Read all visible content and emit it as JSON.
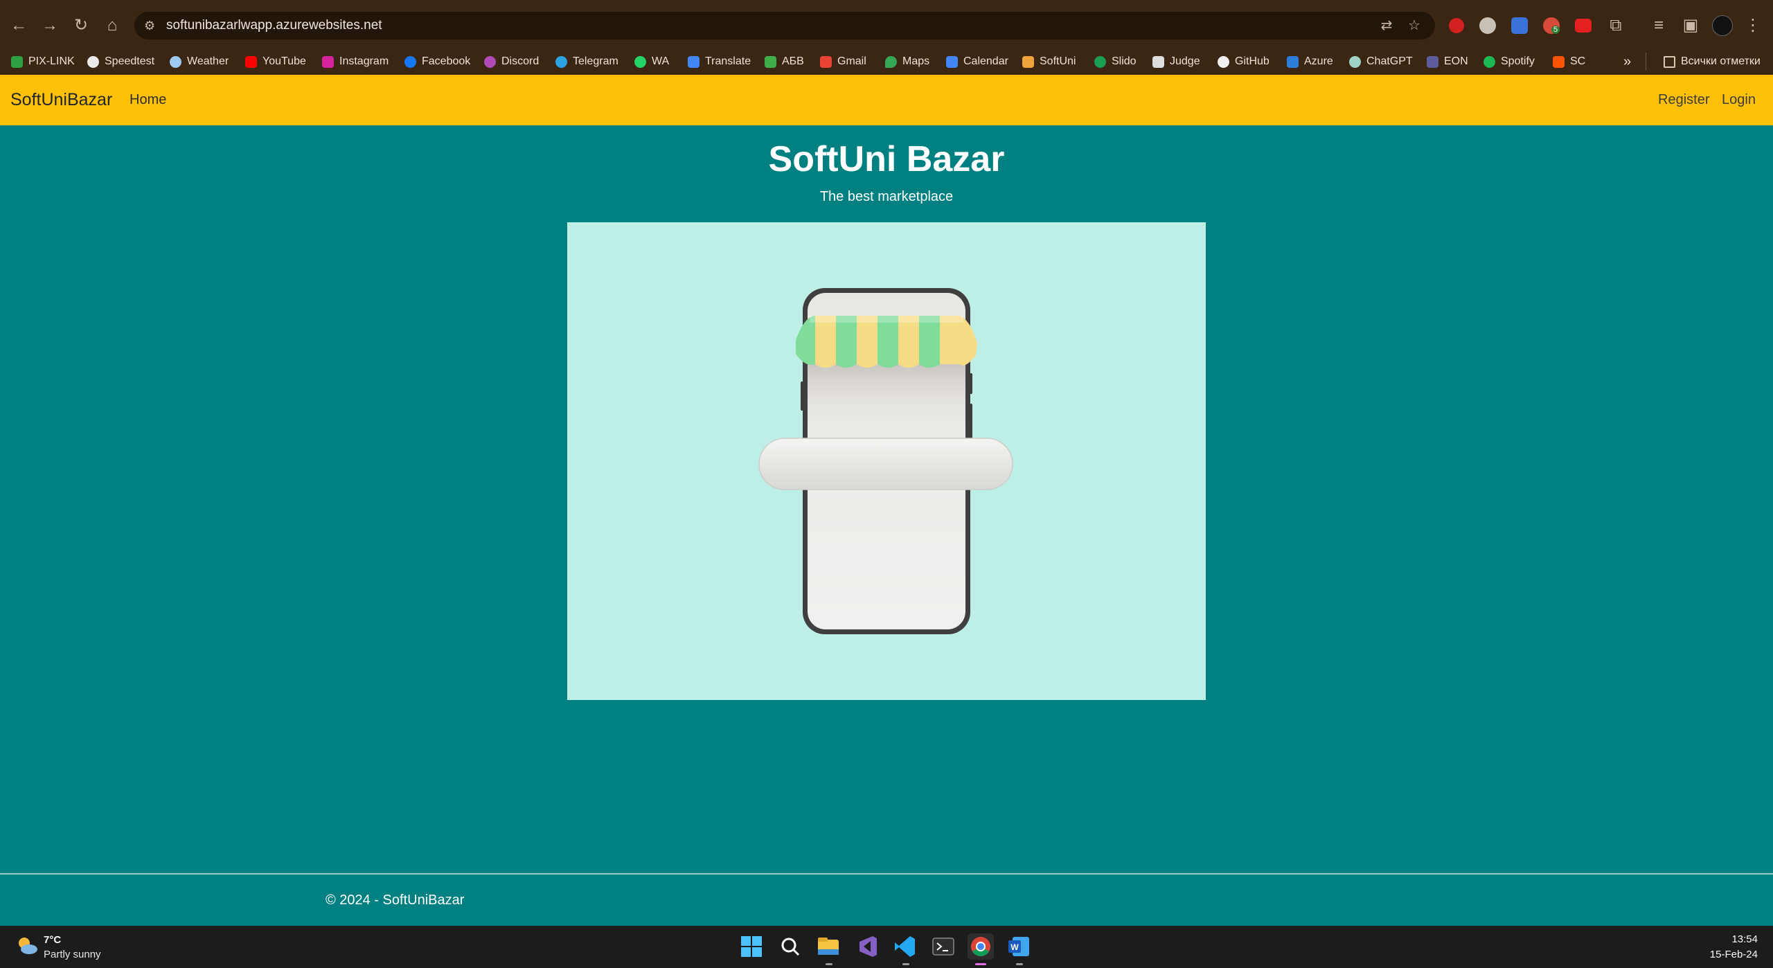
{
  "browser": {
    "url": "softunibazarlwapp.azurewebsites.net",
    "bookmarks": [
      "PIX-LINK",
      "Speedtest",
      "Weather",
      "YouTube",
      "Instagram",
      "Facebook",
      "Discord",
      "Telegram",
      "WA",
      "Translate",
      "АБВ",
      "Gmail",
      "Maps",
      "Calendar",
      "SoftUni",
      "Slido",
      "Judge",
      "GitHub",
      "Azure",
      "ChatGPT",
      "EON",
      "Spotify",
      "SC"
    ],
    "bookmarks_more": "»",
    "all_bookmarks": "Всички отметки",
    "ext_badge": "5",
    "icons": [
      "back-arrow",
      "forward-arrow",
      "reload",
      "home",
      "site-info",
      "translate",
      "star",
      "profile"
    ]
  },
  "navbar": {
    "brand": "SoftUniBazar",
    "home": "Home",
    "register": "Register",
    "login": "Login"
  },
  "main": {
    "title": "SoftUni Bazar",
    "subtitle": "The best marketplace"
  },
  "footer": {
    "text": "© 2024 - SoftUniBazar"
  },
  "taskbar": {
    "weather_temp": "7°C",
    "weather_desc": "Partly sunny",
    "time": "13:54",
    "date": "15-Feb-24",
    "apps": [
      "start",
      "search",
      "file-explorer",
      "visual-studio",
      "vs-code",
      "terminal",
      "chrome",
      "word"
    ]
  },
  "colors": {
    "navbar": "#ffc107",
    "page": "#008080",
    "hero_bg": "#bdefe6",
    "chrome": "#3b2614"
  }
}
